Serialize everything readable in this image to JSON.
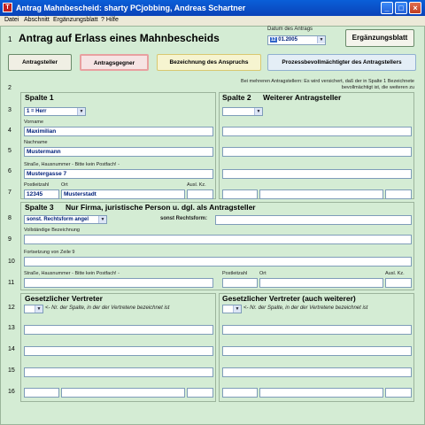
{
  "window": {
    "title": "Antrag Mahnbescheid: sharty PCjobbing, Andreas Schartner",
    "icon": "app-icon"
  },
  "menu": [
    "Datei",
    "Abschnitt",
    "Ergänzungsblatt",
    "? Hilfe"
  ],
  "header": {
    "rownum": "1",
    "title": "Antrag auf Erlass eines Mahnbescheids",
    "date_label": "Datum des Antrags",
    "date_value": "01.2005",
    "date_prefix": "12",
    "ergaenzung_button": "Ergänzungsblatt"
  },
  "tabs": [
    "Antragsteller",
    "Antragsgegner",
    "Bezeichnung des Anspruchs",
    "Prozessbevollmächtigter des Antragstellers"
  ],
  "row_numbers": [
    "2",
    "3",
    "4",
    "5",
    "6",
    "7",
    "8",
    "9",
    "10",
    "11",
    "12",
    "13",
    "14",
    "15",
    "16"
  ],
  "note": "Bei mehreren Antragstellern: Es wird versichert, daß der in Spalte 1 Bezeichnete bevollmächtigt ist, die weiteren zu",
  "spalte1": {
    "header": "Spalte 1",
    "anrede": "1 = Herr",
    "vorname_label": "Vorname",
    "vorname": "Maximilian",
    "name_label": "Nachname",
    "name": "Mustermann",
    "strasse_label": "Straße, Hausnummer - Bitte kein Postfach! -",
    "strasse": "Mustergasse 7",
    "plz_label": "Postleitzahl",
    "ort_label": "Ort",
    "auslkz_label": "Ausl. Kz.",
    "plz": "12345",
    "ort": "Musterstadt"
  },
  "spalte2": {
    "header": "Spalte 2",
    "subheader": "Weiterer Antragsteller"
  },
  "spalte3": {
    "header": "Spalte 3",
    "subheader": "Nur Firma, juristische Person u. dgl. als Antragsteller",
    "rechtsform_select": "sonst. Rechtsform angel",
    "rechtsform_label": "sonst Rechtsform:",
    "bez_label": "Vollständige Bezeichnung",
    "fort_label": "Fortsetzung von Zeile 9",
    "strasse_label": "Straße, Hausnummer - Bitte kein Postfach! -",
    "plz_label": "Postleitzahl",
    "ort_label": "Ort",
    "auslkz_label": "Ausl. Kz."
  },
  "vertreter": {
    "left_header": "Gesetzlicher Vertreter",
    "right_header": "Gesetzlicher Vertreter (auch weiterer)",
    "hint": "<- Nr. der Spalte, in der der Vertretene bezeichnet ist"
  },
  "colors": {
    "titlebar": "#0A4BC8",
    "client_bg": "#D4ECD4",
    "field_text": "#00207a",
    "tab_active_border": "#E08080"
  }
}
